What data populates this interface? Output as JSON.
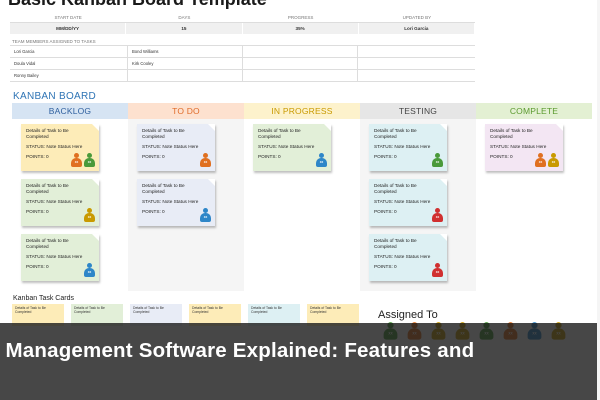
{
  "document": {
    "title": "Basic Kanban Board Template"
  },
  "info": {
    "headers": [
      "START DATE",
      "DAYS",
      "PROGRESS",
      "UPDATED BY"
    ],
    "values": [
      "MM/DD/YY",
      "15",
      "35%",
      "Lori Garcia"
    ]
  },
  "team": {
    "label": "TEAM MEMBERS ASSIGNED TO TASKS",
    "rows": [
      [
        "Lori Garcia",
        "Bond Williams",
        "",
        ""
      ],
      [
        "Doula Vidal",
        "Kirk Cooley",
        "",
        ""
      ],
      [
        "Ronny Bailey",
        "",
        "",
        ""
      ]
    ]
  },
  "kanban": {
    "title": "KANBAN BOARD",
    "columns": [
      {
        "name": "BACKLOG",
        "head_bg": "#d6e4f3",
        "head_color": "#2e5f9e",
        "body_bg": "#ffffff"
      },
      {
        "name": "TO DO",
        "head_bg": "#fde1cf",
        "head_color": "#e06c2a",
        "body_bg": "#f5f5f5"
      },
      {
        "name": "IN PROGRESS",
        "head_bg": "#fdf2cc",
        "head_color": "#c99a00",
        "body_bg": "#ffffff"
      },
      {
        "name": "TESTING",
        "head_bg": "#e6e6e6",
        "head_color": "#444444",
        "body_bg": "#f5f5f5"
      },
      {
        "name": "COMPLETE",
        "head_bg": "#e3f0d3",
        "head_color": "#5b9a2f",
        "body_bg": "#ffffff"
      }
    ],
    "card_title": "Details of Task to Be Completed",
    "card_status": "STATUS: Note Status Here",
    "card_points": "POINTS: 0"
  },
  "cards": [
    {
      "col": 0,
      "row": 0,
      "color": "#fdecb8",
      "avatars": [
        "#e07020",
        "#4a9a3a"
      ]
    },
    {
      "col": 0,
      "row": 1,
      "color": "#e2efd8",
      "avatars": [
        "#c99a00"
      ]
    },
    {
      "col": 0,
      "row": 2,
      "color": "#e2efd8",
      "avatars": [
        "#2e86c8"
      ]
    },
    {
      "col": 1,
      "row": 0,
      "color": "#e8ecf6",
      "avatars": [
        "#e07020"
      ]
    },
    {
      "col": 1,
      "row": 1,
      "color": "#e8ecf6",
      "avatars": [
        "#2e86c8"
      ]
    },
    {
      "col": 2,
      "row": 0,
      "color": "#e2efd8",
      "avatars": [
        "#2e86c8"
      ]
    },
    {
      "col": 3,
      "row": 0,
      "color": "#ddf0f3",
      "avatars": [
        "#4a9a3a"
      ]
    },
    {
      "col": 3,
      "row": 1,
      "color": "#ddf0f3",
      "avatars": [
        "#d03030"
      ]
    },
    {
      "col": 3,
      "row": 2,
      "color": "#ddf0f3",
      "avatars": [
        "#d03030"
      ]
    },
    {
      "col": 4,
      "row": 0,
      "color": "#f3e6f3",
      "avatars": [
        "#e07020",
        "#c99a00"
      ]
    }
  ],
  "task_cards": {
    "title": "Kanban Task Cards",
    "colors": [
      "#fdecb8",
      "#e2efd8",
      "#e8ecf6",
      "#fdecb8",
      "#ddf0f3"
    ],
    "text": "Details of Task to Be Completed"
  },
  "assigned": {
    "title": "Assigned To",
    "avatar_colors": [
      "#4a9a3a",
      "#e07020",
      "#c99a00",
      "#c99a00",
      "#4a9a3a",
      "#e07020",
      "#2e86c8",
      "#c99a00"
    ]
  },
  "banner": {
    "text": "k Management Software Explained: Features and"
  },
  "colors": {
    "accent": "#2e74b5",
    "banner_bg": "#1e1e1e"
  }
}
